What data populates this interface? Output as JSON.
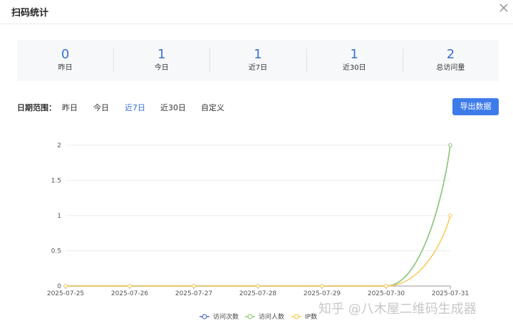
{
  "dialog": {
    "title": "扫码统计"
  },
  "stats": [
    {
      "value": "0",
      "label": "昨日"
    },
    {
      "value": "1",
      "label": "今日"
    },
    {
      "value": "1",
      "label": "近7日"
    },
    {
      "value": "1",
      "label": "近30日"
    },
    {
      "value": "2",
      "label": "总访问量"
    }
  ],
  "filter": {
    "label": "日期范围：",
    "options": [
      "昨日",
      "今日",
      "近7日",
      "近30日",
      "自定义"
    ],
    "active_option": "近7日",
    "export_label": "导出数据"
  },
  "watermark": "知乎 @八木屋二维码生成器",
  "colors": {
    "accent": "#3e7bea",
    "series_visits": "#5470c6",
    "series_visitors": "#91cc75",
    "series_ip": "#fac858"
  },
  "chart_data": {
    "type": "line",
    "x": [
      "2025-07-25",
      "2025-07-26",
      "2025-07-27",
      "2025-07-28",
      "2025-07-29",
      "2025-07-30",
      "2025-07-31"
    ],
    "ylim": [
      0,
      2
    ],
    "yticks": [
      "0",
      "0.5",
      "1",
      "1.5",
      "2"
    ],
    "grid": true,
    "legend_position": "bottom-center",
    "series": [
      {
        "name": "访问次数",
        "values": [
          0,
          0,
          0,
          0,
          0,
          0,
          2
        ],
        "color": "#5470c6"
      },
      {
        "name": "访问人数",
        "values": [
          0,
          0,
          0,
          0,
          0,
          0,
          2
        ],
        "color": "#91cc75"
      },
      {
        "name": "IP数",
        "values": [
          0,
          0,
          0,
          0,
          0,
          0,
          1
        ],
        "color": "#fac858"
      }
    ]
  }
}
